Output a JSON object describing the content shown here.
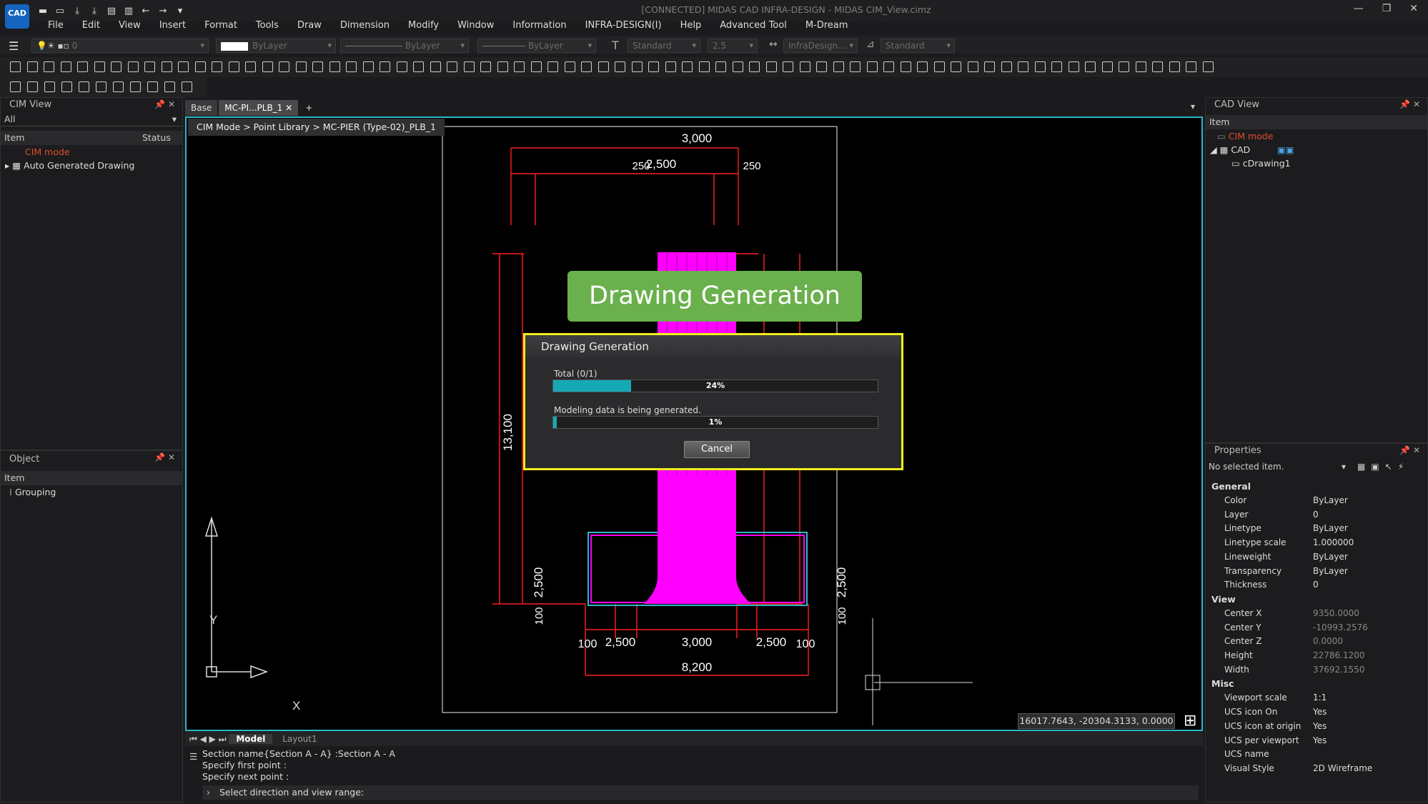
{
  "app": {
    "title": "[CONNECTED] MIDAS CAD INFRA-DESIGN - MIDAS CIM_View.cimz",
    "logo": "CAD"
  },
  "menu": [
    "File",
    "Edit",
    "View",
    "Insert",
    "Format",
    "Tools",
    "Draw",
    "Dimension",
    "Modify",
    "Window",
    "Information",
    "INFRA-DESIGN(I)",
    "Help",
    "Advanced Tool",
    "M-Dream"
  ],
  "props_toolbar": {
    "layer": "0",
    "color": "ByLayer",
    "linetype": "ByLayer",
    "lineweight": "ByLayer",
    "textstyle": "Standard",
    "textheight": "2.5",
    "dimstyle": "InfraDesign...",
    "tablestyle": "Standard"
  },
  "cim_view": {
    "title": "CIM View",
    "filter": "All",
    "col_item": "Item",
    "col_status": "Status",
    "items": [
      "CIM mode",
      "Auto Generated Drawing"
    ]
  },
  "object_panel": {
    "title": "Object",
    "col_item": "Item",
    "items": [
      "Grouping"
    ]
  },
  "tabs": [
    "Base",
    "MC-PI...PLB_1",
    "+"
  ],
  "breadcrumb": "CIM Mode > Point Library > MC-PIER (Type-02)_PLB_1",
  "banner": "Drawing Generation",
  "dialog": {
    "title": "Drawing Generation",
    "total_label": "Total (0/1)",
    "total_progress": 0.24,
    "total_text": "24%",
    "sub_label": "Modeling data is being generated.",
    "sub_progress": 0.01,
    "sub_text": "1%",
    "cancel": "Cancel"
  },
  "dims": {
    "top_total": "3,000",
    "top_left": "250",
    "top_mid": "2,500",
    "top_right": "250",
    "height": "13,100",
    "left_footing": "2,500",
    "left_base": "100",
    "right_footing": "2,500",
    "right_base": "100",
    "bot_100a": "100",
    "bot_2500a": "2,500",
    "bot_3000": "3,000",
    "bot_2500b": "2,500",
    "bot_100b": "100",
    "bot_total": "8,200"
  },
  "axis": {
    "x": "X",
    "y": "Y"
  },
  "coord": "16017.7643, -20304.3133, 0.0000",
  "layout_tabs": [
    "Model",
    "Layout1"
  ],
  "command": {
    "lines": [
      "Section name{Section A - A} :Section A - A",
      "Specify first point :",
      "Specify next point :"
    ],
    "prompt": "Select direction and view range:"
  },
  "cad_view": {
    "title": "CAD View",
    "col_item": "Item",
    "items": [
      "CIM mode",
      "CAD",
      "cDrawing1"
    ]
  },
  "properties": {
    "title": "Properties",
    "selection": "No selected item.",
    "general_label": "General",
    "general": [
      [
        "Color",
        "ByLayer"
      ],
      [
        "Layer",
        "0"
      ],
      [
        "Linetype",
        "ByLayer"
      ],
      [
        "Linetype scale",
        "1.000000"
      ],
      [
        "Lineweight",
        "ByLayer"
      ],
      [
        "Transparency",
        "ByLayer"
      ],
      [
        "Thickness",
        "0"
      ]
    ],
    "view_label": "View",
    "view": [
      [
        "Center X",
        "9350.0000"
      ],
      [
        "Center Y",
        "-10993.2576"
      ],
      [
        "Center Z",
        "0.0000"
      ],
      [
        "Height",
        "22786.1200"
      ],
      [
        "Width",
        "37692.1550"
      ]
    ],
    "misc_label": "Misc",
    "misc": [
      [
        "Viewport scale",
        "1:1"
      ],
      [
        "UCS icon On",
        "Yes"
      ],
      [
        "UCS icon at origin",
        "Yes"
      ],
      [
        "UCS per viewport",
        "Yes"
      ],
      [
        "UCS name",
        ""
      ],
      [
        "Visual Style",
        "2D Wireframe"
      ]
    ]
  },
  "colors": {
    "accent": "#2cb6c8",
    "highlight": "#f2ee1a",
    "banner": "#6ab04c",
    "dim": "#ff2020",
    "magenta": "#ff00ff"
  }
}
